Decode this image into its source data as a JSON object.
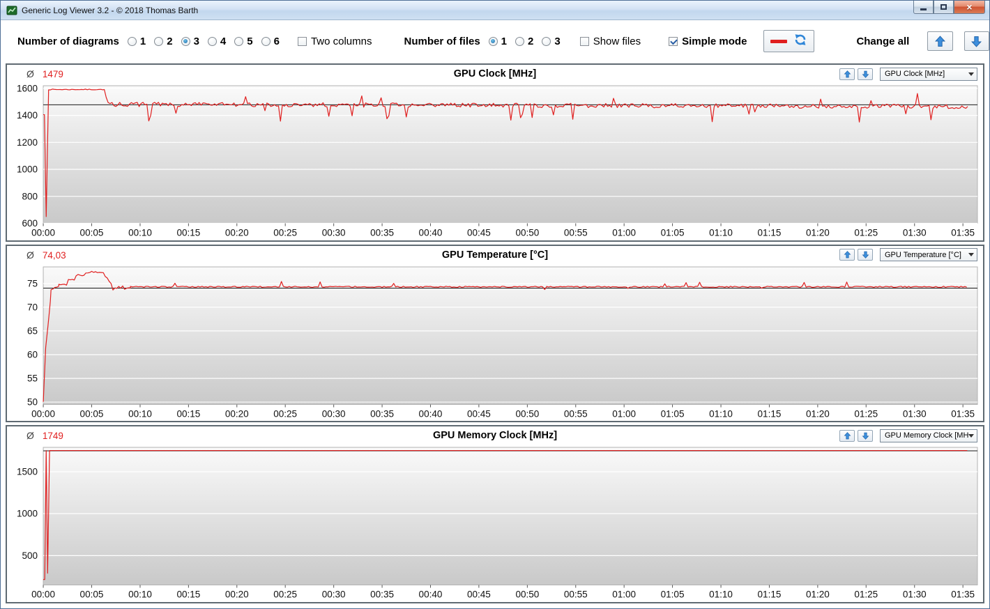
{
  "window": {
    "title": "Generic Log Viewer 3.2 - © 2018 Thomas Barth"
  },
  "toolbar": {
    "diagrams_label": "Number of diagrams",
    "diagram_options": [
      "1",
      "2",
      "3",
      "4",
      "5",
      "6"
    ],
    "diagrams_selected": "3",
    "two_columns_label": "Two columns",
    "two_columns_checked": false,
    "files_label": "Number of files",
    "file_options": [
      "1",
      "2",
      "3"
    ],
    "files_selected": "1",
    "show_files_label": "Show files",
    "show_files_checked": false,
    "simple_mode_label": "Simple mode",
    "simple_mode_checked": true,
    "change_all_label": "Change all"
  },
  "panels": [
    {
      "avg_symbol": "Ø",
      "avg_value": "1479",
      "title": "GPU Clock [MHz]",
      "dropdown_value": "GPU Clock [MHz]"
    },
    {
      "avg_symbol": "Ø",
      "avg_value": "74,03",
      "title": "GPU Temperature [°C]",
      "dropdown_value": "GPU Temperature [°C]"
    },
    {
      "avg_symbol": "Ø",
      "avg_value": "1749",
      "title": "GPU Memory Clock [MHz]",
      "dropdown_value": "GPU Memory Clock [MHz]"
    }
  ],
  "colors": {
    "series_red": "#e01f1f",
    "average_value_red": "#e01f1f",
    "arrow_blue": "#2f86d8",
    "avg_line_black": "#1a1a1a",
    "plot_gradient_top": "#fafafa",
    "plot_gradient_bottom": "#c9c9c9"
  },
  "chart_data": [
    {
      "type": "line",
      "title": "GPU Clock [MHz]",
      "ylabel": "MHz",
      "average": 1479,
      "avg_line": 1479,
      "color": "#e01f1f",
      "xlim": [
        0,
        96.5
      ],
      "ylim": [
        600,
        1620
      ],
      "yticks": [
        600,
        800,
        1000,
        1200,
        1400,
        1600
      ],
      "xticks": [
        "00:00",
        "00:05",
        "00:10",
        "00:15",
        "00:20",
        "00:25",
        "00:30",
        "00:35",
        "00:40",
        "00:45",
        "00:50",
        "00:55",
        "01:00",
        "01:05",
        "01:10",
        "01:15",
        "01:20",
        "01:25",
        "01:30",
        "01:35"
      ],
      "xtick_minutes": [
        0,
        5,
        10,
        15,
        20,
        25,
        30,
        35,
        40,
        45,
        50,
        55,
        60,
        65,
        70,
        75,
        80,
        85,
        90,
        95
      ],
      "series_spec": {
        "seed": 7,
        "dt": 0.2,
        "segments": [
          {
            "t0": 0,
            "t1": 0.12,
            "v0": 1405,
            "v1": 1405,
            "noise": 0
          },
          {
            "t0": 0.12,
            "t1": 0.3,
            "v0": 1405,
            "v1": 650,
            "noise": 0,
            "dt": 0.09
          },
          {
            "t0": 0.3,
            "t1": 0.55,
            "v0": 650,
            "v1": 1592,
            "noise": 0,
            "dt": 0.12
          },
          {
            "t0": 0.55,
            "t1": 6.3,
            "v0": 1592,
            "v1": 1592,
            "noise": 3
          },
          {
            "t0": 6.3,
            "t1": 6.7,
            "v0": 1592,
            "v1": 1475,
            "noise": 0
          },
          {
            "t0": 6.7,
            "t1": 95.6,
            "v0": 1482,
            "v1": 1466,
            "noise": 16,
            "spikes": [
              {
                "prob": 0.045,
                "amp": -85
              },
              {
                "prob": 0.02,
                "amp": 70
              }
            ]
          }
        ]
      }
    },
    {
      "type": "line",
      "title": "GPU Temperature [°C]",
      "ylabel": "°C",
      "average": 74.03,
      "avg_line": 74.03,
      "color": "#e01f1f",
      "xlim": [
        0,
        96.5
      ],
      "ylim": [
        49.5,
        78.5
      ],
      "yticks": [
        50,
        55,
        60,
        65,
        70,
        75
      ],
      "xticks": [
        "00:00",
        "00:05",
        "00:10",
        "00:15",
        "00:20",
        "00:25",
        "00:30",
        "00:35",
        "00:40",
        "00:45",
        "00:50",
        "00:55",
        "01:00",
        "01:05",
        "01:10",
        "01:15",
        "01:20",
        "01:25",
        "01:30",
        "01:35"
      ],
      "xtick_minutes": [
        0,
        5,
        10,
        15,
        20,
        25,
        30,
        35,
        40,
        45,
        50,
        55,
        60,
        65,
        70,
        75,
        80,
        85,
        90,
        95
      ],
      "series_spec": {
        "seed": 13,
        "dt": 0.2,
        "segments": [
          {
            "t0": 0,
            "t1": 0.25,
            "v0": 50,
            "v1": 62,
            "noise": 0.5,
            "dt": 0.08
          },
          {
            "t0": 0.25,
            "t1": 0.8,
            "v0": 62,
            "v1": 72.5,
            "noise": 0.5,
            "dt": 0.12
          },
          {
            "t0": 0.8,
            "t1": 1.6,
            "v0": 73.5,
            "v1": 74.6,
            "noise": 0.25
          },
          {
            "t0": 1.6,
            "t1": 2.6,
            "v0": 74.8,
            "v1": 74.8,
            "noise": 0.2
          },
          {
            "t0": 2.6,
            "t1": 3.4,
            "v0": 75.8,
            "v1": 75.8,
            "noise": 0.2
          },
          {
            "t0": 3.4,
            "t1": 4.4,
            "v0": 76.8,
            "v1": 76.8,
            "noise": 0.2
          },
          {
            "t0": 4.4,
            "t1": 6.2,
            "v0": 77.4,
            "v1": 77.4,
            "noise": 0.2
          },
          {
            "t0": 6.2,
            "t1": 7.2,
            "v0": 77.2,
            "v1": 74.6,
            "noise": 0.2
          },
          {
            "t0": 7.2,
            "t1": 9.0,
            "v0": 74.2,
            "v1": 74.3,
            "noise": 0.3,
            "spikes": [
              {
                "prob": 0.15,
                "amp": -0.8
              }
            ]
          },
          {
            "t0": 9.0,
            "t1": 95.6,
            "v0": 74.3,
            "v1": 74.3,
            "noise": 0.12,
            "spikes": [
              {
                "prob": 0.018,
                "amp": 1.0
              },
              {
                "prob": 0.01,
                "amp": -0.6
              }
            ]
          }
        ]
      }
    },
    {
      "type": "line",
      "title": "GPU Memory Clock [MHz]",
      "ylabel": "MHz",
      "average": 1749,
      "avg_line": 1749,
      "color": "#e01f1f",
      "xlim": [
        0,
        96.5
      ],
      "ylim": [
        150,
        1790
      ],
      "yticks": [
        500,
        1000,
        1500
      ],
      "xticks": [
        "00:00",
        "00:05",
        "00:10",
        "00:15",
        "00:20",
        "00:25",
        "00:30",
        "00:35",
        "00:40",
        "00:45",
        "00:50",
        "00:55",
        "01:00",
        "01:05",
        "01:10",
        "01:15",
        "01:20",
        "01:25",
        "01:30",
        "01:35"
      ],
      "xtick_minutes": [
        0,
        5,
        10,
        15,
        20,
        25,
        30,
        35,
        40,
        45,
        50,
        55,
        60,
        65,
        70,
        75,
        80,
        85,
        90,
        95
      ],
      "series_spec": {
        "seed": 5,
        "dt": 0.2,
        "segments": [
          {
            "t0": 0,
            "t1": 0.15,
            "v0": 215,
            "v1": 215,
            "noise": 0,
            "dt": 0.07
          },
          {
            "t0": 0.15,
            "t1": 0.3,
            "v0": 215,
            "v1": 1752,
            "noise": 0,
            "dt": 0.07
          },
          {
            "t0": 0.3,
            "t1": 0.45,
            "v0": 1752,
            "v1": 290,
            "noise": 0,
            "dt": 0.07
          },
          {
            "t0": 0.45,
            "t1": 0.65,
            "v0": 290,
            "v1": 1752,
            "noise": 0,
            "dt": 0.09
          },
          {
            "t0": 0.65,
            "t1": 95.6,
            "v0": 1752,
            "v1": 1752,
            "noise": 0
          }
        ]
      }
    }
  ]
}
